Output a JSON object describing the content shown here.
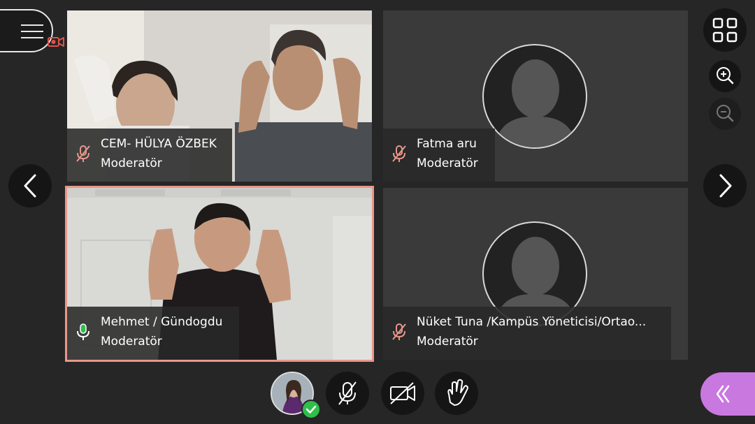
{
  "participants": [
    {
      "name": "CEM- HÜLYA ÖZBEK",
      "role": "Moderatör",
      "mic": "muted"
    },
    {
      "name": "Fatma aru",
      "role": "Moderatör",
      "mic": "muted"
    },
    {
      "name": "Mehmet / Gündogdu",
      "role": "Moderatör",
      "mic": "active"
    },
    {
      "name": "Nüket Tuna /Kampüs Yöneticisi/Ortao...",
      "role": "Moderatör",
      "mic": "muted"
    }
  ],
  "colors": {
    "background": "#262626",
    "tile": "#3a3a3a",
    "active_border": "#e8978a",
    "muted_icon": "#e8978a",
    "mic_active": "#2fbf4a",
    "panel_tab": "#c978e0"
  },
  "icons": {
    "menu": "hamburger-icon",
    "recording": "recording-camera-icon",
    "grid": "grid-view-icon",
    "zoom_in": "zoom-in-icon",
    "zoom_out": "zoom-out-icon",
    "prev": "chevron-left-icon",
    "next": "chevron-right-icon",
    "mic": "mic-off-icon",
    "camera": "camera-off-icon",
    "hand": "raise-hand-icon",
    "panel": "double-chevron-left-icon"
  }
}
